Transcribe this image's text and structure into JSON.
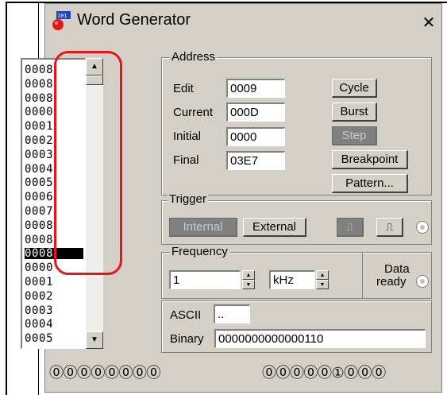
{
  "window": {
    "title": "Word Generator",
    "close_symbol": "✕"
  },
  "memory": {
    "rows": [
      "0008",
      "0008",
      "0008",
      "0000",
      "0001",
      "0002",
      "0003",
      "0004",
      "0005",
      "0006",
      "0007",
      "0008",
      "0008",
      "0008",
      "0000",
      "0001",
      "0002",
      "0003",
      "0004",
      "0005"
    ],
    "selected_index": 13
  },
  "address": {
    "group_label": "Address",
    "edit_label": "Edit",
    "edit_value": "0009",
    "current_label": "Current",
    "current_value": "000D",
    "initial_label": "Initial",
    "initial_value": "0000",
    "final_label": "Final",
    "final_value": "03E7",
    "cycle": "Cycle",
    "burst": "Burst",
    "step": "Step",
    "breakpoint": "Breakpoint",
    "pattern": "Pattern..."
  },
  "trigger": {
    "group_label": "Trigger",
    "internal": "Internal",
    "external": "External"
  },
  "frequency": {
    "group_label": "Frequency",
    "value": "1",
    "unit": "kHz",
    "data_ready_line1": "Data",
    "data_ready_line2": "ready"
  },
  "ascii": {
    "label": "ASCII",
    "value": ".."
  },
  "binary": {
    "label": "Binary",
    "value": "0000000000000110"
  },
  "output_bits": {
    "group1": "⓪⓪⓪⓪⓪⓪⓪⓪",
    "group2": "⓪⓪⓪⓪⓪①⓪⓪⓪"
  }
}
